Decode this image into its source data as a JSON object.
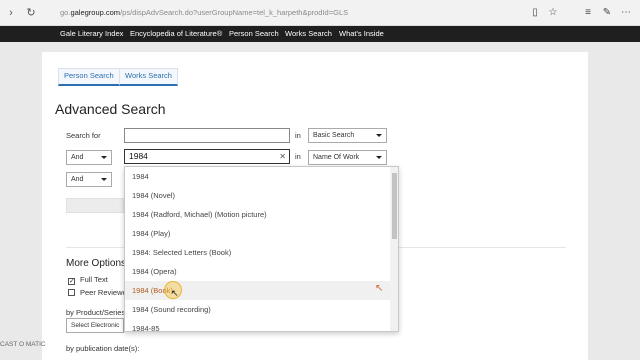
{
  "browser": {
    "url_prefix": "go.",
    "url_domain": "galegroup.com",
    "url_path": "/ps/dispAdvSearch.do?userGroupName=tel_k_harpeth&prodId=GLS"
  },
  "gale_nav": [
    "Gale Literary Index",
    "Encyclopedia of Literature®",
    "Person Search",
    "Works Search",
    "What's Inside"
  ],
  "tabs": [
    "Person Search",
    "Works Search"
  ],
  "title": "Advanced Search",
  "search": {
    "search_for_label": "Search for",
    "in_label": "in",
    "row1_scope": "Basic Search",
    "row2_operator": "And",
    "row2_value": "1984",
    "row2_scope": "Name Of Work",
    "row3_operator": "And"
  },
  "suggestions": [
    "1984",
    "1984 (Novel)",
    "1984 (Radford, Michael) (Motion picture)",
    "1984 (Play)",
    "1984: Selected Letters (Book)",
    "1984 (Opera)",
    "1984 (Book)",
    "1984 (Sound recording)",
    "1984-85"
  ],
  "more_options": {
    "title": "More Options",
    "full_text": "Full Text",
    "peer_reviewed": "Peer Reviewe",
    "product_label": "by Product/Series",
    "product_value": "Select Electronic",
    "pub_date_label": "by publication date(s):"
  },
  "watermark": "CAST O MATIC"
}
